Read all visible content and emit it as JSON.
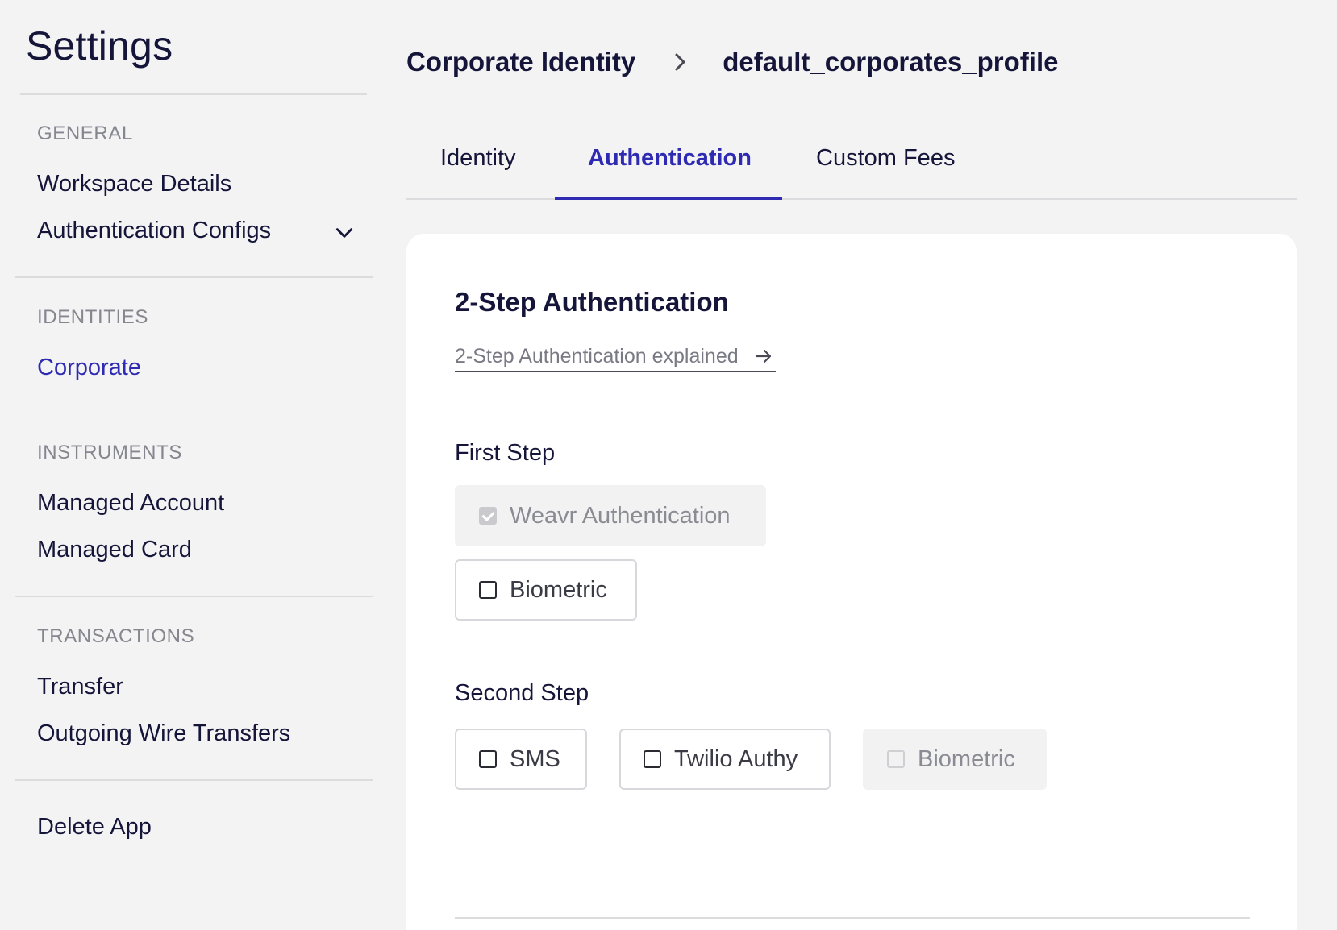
{
  "sidebar": {
    "title": "Settings",
    "sections": [
      {
        "label": "GENERAL",
        "items": [
          {
            "label": "Workspace Details"
          },
          {
            "label": "Authentication Configs",
            "icon": "chevron-down-icon"
          }
        ]
      },
      {
        "label": "IDENTITIES",
        "items": [
          {
            "label": "Corporate",
            "active": true
          }
        ]
      },
      {
        "label": "INSTRUMENTS",
        "items": [
          {
            "label": "Managed Account"
          },
          {
            "label": "Managed Card"
          }
        ]
      },
      {
        "label": "TRANSACTIONS",
        "items": [
          {
            "label": "Transfer"
          },
          {
            "label": "Outgoing Wire Transfers"
          }
        ]
      }
    ],
    "delete_app": "Delete App"
  },
  "breadcrumb": {
    "parent": "Corporate Identity",
    "current": "default_corporates_profile"
  },
  "tabs": [
    {
      "label": "Identity"
    },
    {
      "label": "Authentication",
      "active": true
    },
    {
      "label": "Custom Fees"
    }
  ],
  "card": {
    "title": "2-Step Authentication",
    "explain_link": "2-Step Authentication explained",
    "first_step": {
      "label": "First Step",
      "options": [
        {
          "label": "Weavr Authentication",
          "checked": true,
          "disabled": true
        },
        {
          "label": "Biometric",
          "checked": false,
          "disabled": false
        }
      ]
    },
    "second_step": {
      "label": "Second Step",
      "options": [
        {
          "label": "SMS",
          "checked": false,
          "disabled": false
        },
        {
          "label": "Twilio Authy",
          "checked": false,
          "disabled": false
        },
        {
          "label": "Biometric",
          "checked": false,
          "disabled": true
        }
      ]
    }
  },
  "colors": {
    "accent": "#2e2ab1",
    "text": "#15153a",
    "muted": "#86868f",
    "background": "#f3f3f4",
    "card": "#ffffff"
  }
}
